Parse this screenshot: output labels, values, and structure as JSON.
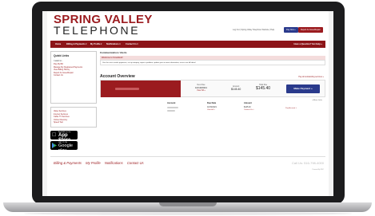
{
  "brand": {
    "line1": "SPRING VALLEY",
    "line2": "TELEPHONE",
    "color": "#9b1b1f"
  },
  "top_links": "Log Out | Spring Valley Telephone Website | Help",
  "top_buttons": {
    "pay_now": "Pay Now »",
    "repair": "Report An Issue/Repair"
  },
  "nav": {
    "items": [
      "Home",
      "Billing & Payments ▾",
      "My Profile ▾",
      "Notifications ▾",
      "Contact Us ▾"
    ],
    "help": "Have a Question? Get Help »"
  },
  "sidebar": {
    "quick_links_title": "Quick Links",
    "i_want_to": "I want to...",
    "links": [
      "Pay My Bill",
      "Manage My Registered Payments",
      "View Billing History",
      "Report An Issue/Repair",
      "Contact Us"
    ],
    "resources": [
      "Value Services",
      "Internet Services",
      "Cable TV Services",
      "Online Directory",
      "Speed Test"
    ]
  },
  "badges": {
    "app_store": {
      "small": "Available on the",
      "big": "App Store"
    },
    "google_play": {
      "small": "GET IT ON",
      "big": "Google play"
    }
  },
  "main": {
    "comm_title": "Communication / Alerts",
    "alert_head": "Welcome to SmartHub!",
    "alert_body": "Use this site to make payments, set up autopay, report a problem, update your account information, access our bill detail",
    "overview_title": "Account Overview",
    "overview_link": "Pay all outstanding services »",
    "next_due_label": "Next Due",
    "next_due_date": "10/19/2021",
    "view_bill": "View bill »",
    "amount_label": "Amount",
    "amount_value": "$145.40",
    "total_due_label": "Total Due",
    "total_due_value": "$145.40",
    "make_payment": "Make Payment »",
    "more_links": "▾ More Links",
    "hist_headers": {
      "account": "Account",
      "due_date": "Due Date",
      "amount": "Amount"
    },
    "hist_due": "10/19/2021",
    "hist_view_bill": "View bill »",
    "hist_amount": "$145.40",
    "hist_contact": "Contact Us »",
    "hist_pay": "Pay Account »"
  },
  "footer": {
    "links": [
      "Billing & Payments",
      "My Profile",
      "Notifications",
      "Contact Us"
    ],
    "call": "Call Us: 516-798-4000",
    "tiny": "Powered By NISC"
  }
}
